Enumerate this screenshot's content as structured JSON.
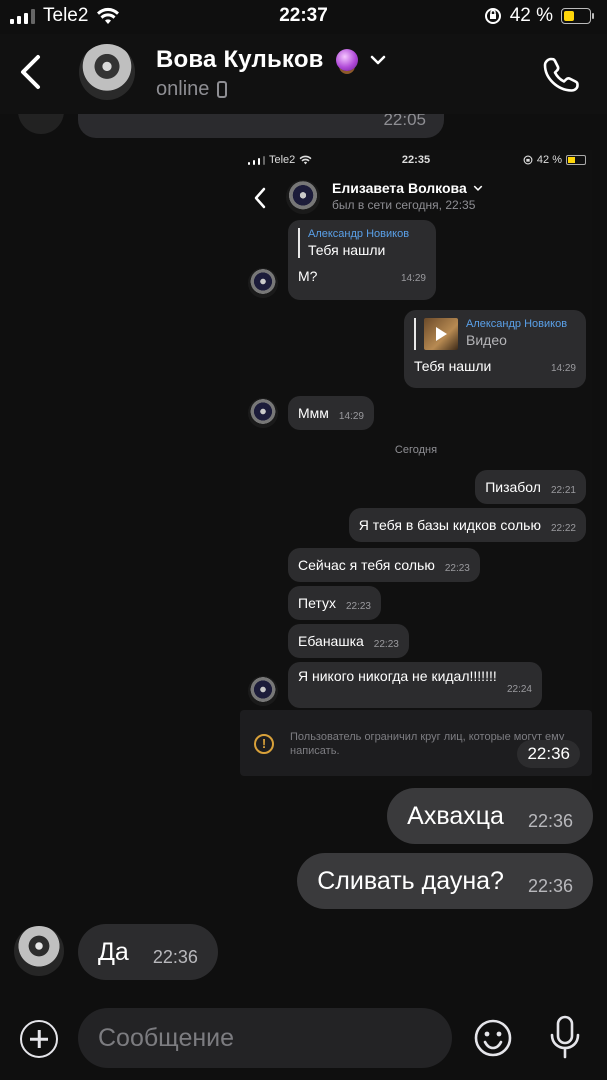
{
  "status_bar": {
    "carrier": "Tele2",
    "time": "22:37",
    "battery_percent": "42 %",
    "battery_level": 0.42
  },
  "header": {
    "contact_name": "Вова Кульков",
    "status": "online",
    "icons": [
      "back-chevron-icon",
      "crystal-ball-emoji",
      "chevron-down-icon",
      "mobile-device-icon",
      "phone-icon"
    ]
  },
  "previous_message": {
    "time": "22:05"
  },
  "screenshot": {
    "status_bar": {
      "carrier": "Tele2",
      "time": "22:35",
      "battery": "42 %"
    },
    "header": {
      "name": "Елизавета Волкова",
      "seen": "был в сети сегодня, 22:35"
    },
    "messages": [
      {
        "reply_author": "Александр Новиков",
        "reply_text": "Тебя нашли",
        "text": "М?",
        "time": "14:29"
      },
      {
        "reply_author": "Александр Новиков",
        "reply_text": "Видео",
        "text": "Тебя нашли",
        "time": "14:29"
      },
      {
        "text": "Ммм",
        "time": "14:29"
      },
      {
        "text": "Пизабол",
        "time": "22:21"
      },
      {
        "text": "Я тебя в базы кидков солью",
        "time": "22:22"
      },
      {
        "text": "Сейчас я тебя солью",
        "time": "22:23"
      },
      {
        "text": "Петух",
        "time": "22:23"
      },
      {
        "text": "Ебанашка",
        "time": "22:23"
      },
      {
        "text": "Я никого никогда не кидал!!!!!!!",
        "time": "22:24"
      }
    ],
    "day_separator": "Сегодня",
    "restriction_notice": "Пользователь ограничил круг лиц, которые могут ему написать.",
    "restriction_icon": "exclamation-circle-icon"
  },
  "screenshot_time": "22:36",
  "outgoing": [
    {
      "text": "Ахвахца",
      "time": "22:36"
    },
    {
      "text": "Сливать дауна?",
      "time": "22:36"
    }
  ],
  "incoming": [
    {
      "text": "Да",
      "time": "22:36"
    }
  ],
  "input": {
    "placeholder": "Сообщение",
    "value": "",
    "icons": [
      "plus-icon",
      "emoji-icon",
      "microphone-icon"
    ]
  }
}
